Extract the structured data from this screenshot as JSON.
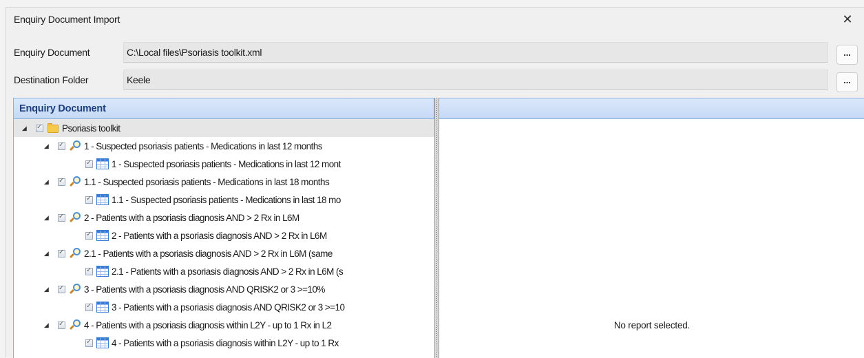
{
  "window": {
    "title": "Enquiry Document Import",
    "close_glyph": "✕"
  },
  "fields": {
    "enquiry_document": {
      "label": "Enquiry Document",
      "value": "C:\\Local files\\Psoriasis toolkit.xml",
      "browse_label": "..."
    },
    "destination_folder": {
      "label": "Destination Folder",
      "value": "Keele",
      "browse_label": "..."
    }
  },
  "left_panel": {
    "header": "Enquiry Document",
    "tree": {
      "root": {
        "label": "Psoriasis toolkit",
        "icon": "folder-icon"
      },
      "items": [
        {
          "search": "1 - Suspected psoriasis patients - Medications in last 12 months",
          "report": "1 - Suspected psoriasis patients - Medications in last 12 mont"
        },
        {
          "search": "1.1 - Suspected psoriasis patients - Medications in last 18 months",
          "report": "1.1 - Suspected psoriasis patients - Medications in last 18 mo"
        },
        {
          "search": "2 - Patients with a psoriasis diagnosis AND > 2 Rx in L6M",
          "report": "2 - Patients with a psoriasis diagnosis AND > 2 Rx in L6M"
        },
        {
          "search": "2.1 - Patients with a psoriasis diagnosis AND > 2 Rx in L6M (same",
          "report": "2.1 - Patients with a psoriasis diagnosis AND > 2 Rx in L6M (s"
        },
        {
          "search": "3 - Patients with a psoriasis diagnosis AND QRISK2 or 3 >=10%",
          "report": "3 - Patients with a psoriasis diagnosis AND QRISK2 or 3 >=10"
        },
        {
          "search": "4 - Patients with a psoriasis diagnosis within L2Y - up to 1 Rx in L2",
          "report": "4 - Patients with a psoriasis diagnosis within L2Y - up to 1 Rx"
        }
      ]
    }
  },
  "right_panel": {
    "header": "",
    "empty_message": "No report selected."
  },
  "icons": {
    "expander": "◢",
    "search_item": "search-icon",
    "report_item": "report-table-icon"
  },
  "colors": {
    "panel_header_text": "#1e3f7a",
    "panel_header_bg": "#c5d9f6",
    "panel_border": "#8eb1de"
  }
}
